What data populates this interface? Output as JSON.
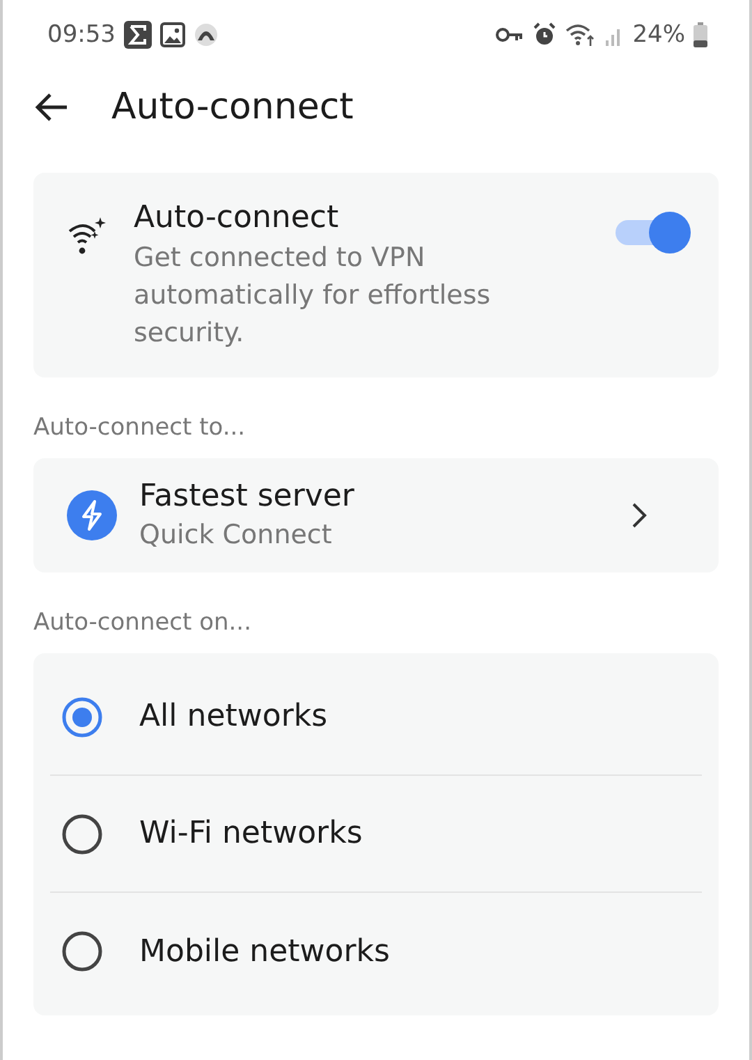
{
  "status_bar": {
    "time": "09:53",
    "battery": "24%"
  },
  "header": {
    "title": "Auto-connect"
  },
  "auto_connect": {
    "title": "Auto-connect",
    "description": "Get connected to VPN automatically for effortless security.",
    "on": true
  },
  "connect_to": {
    "label": "Auto-connect to...",
    "server": {
      "title": "Fastest server",
      "subtitle": "Quick Connect"
    }
  },
  "connect_on": {
    "label": "Auto-connect on...",
    "options": [
      {
        "label": "All networks",
        "selected": true
      },
      {
        "label": "Wi-Fi networks",
        "selected": false
      },
      {
        "label": "Mobile networks",
        "selected": false
      }
    ]
  }
}
